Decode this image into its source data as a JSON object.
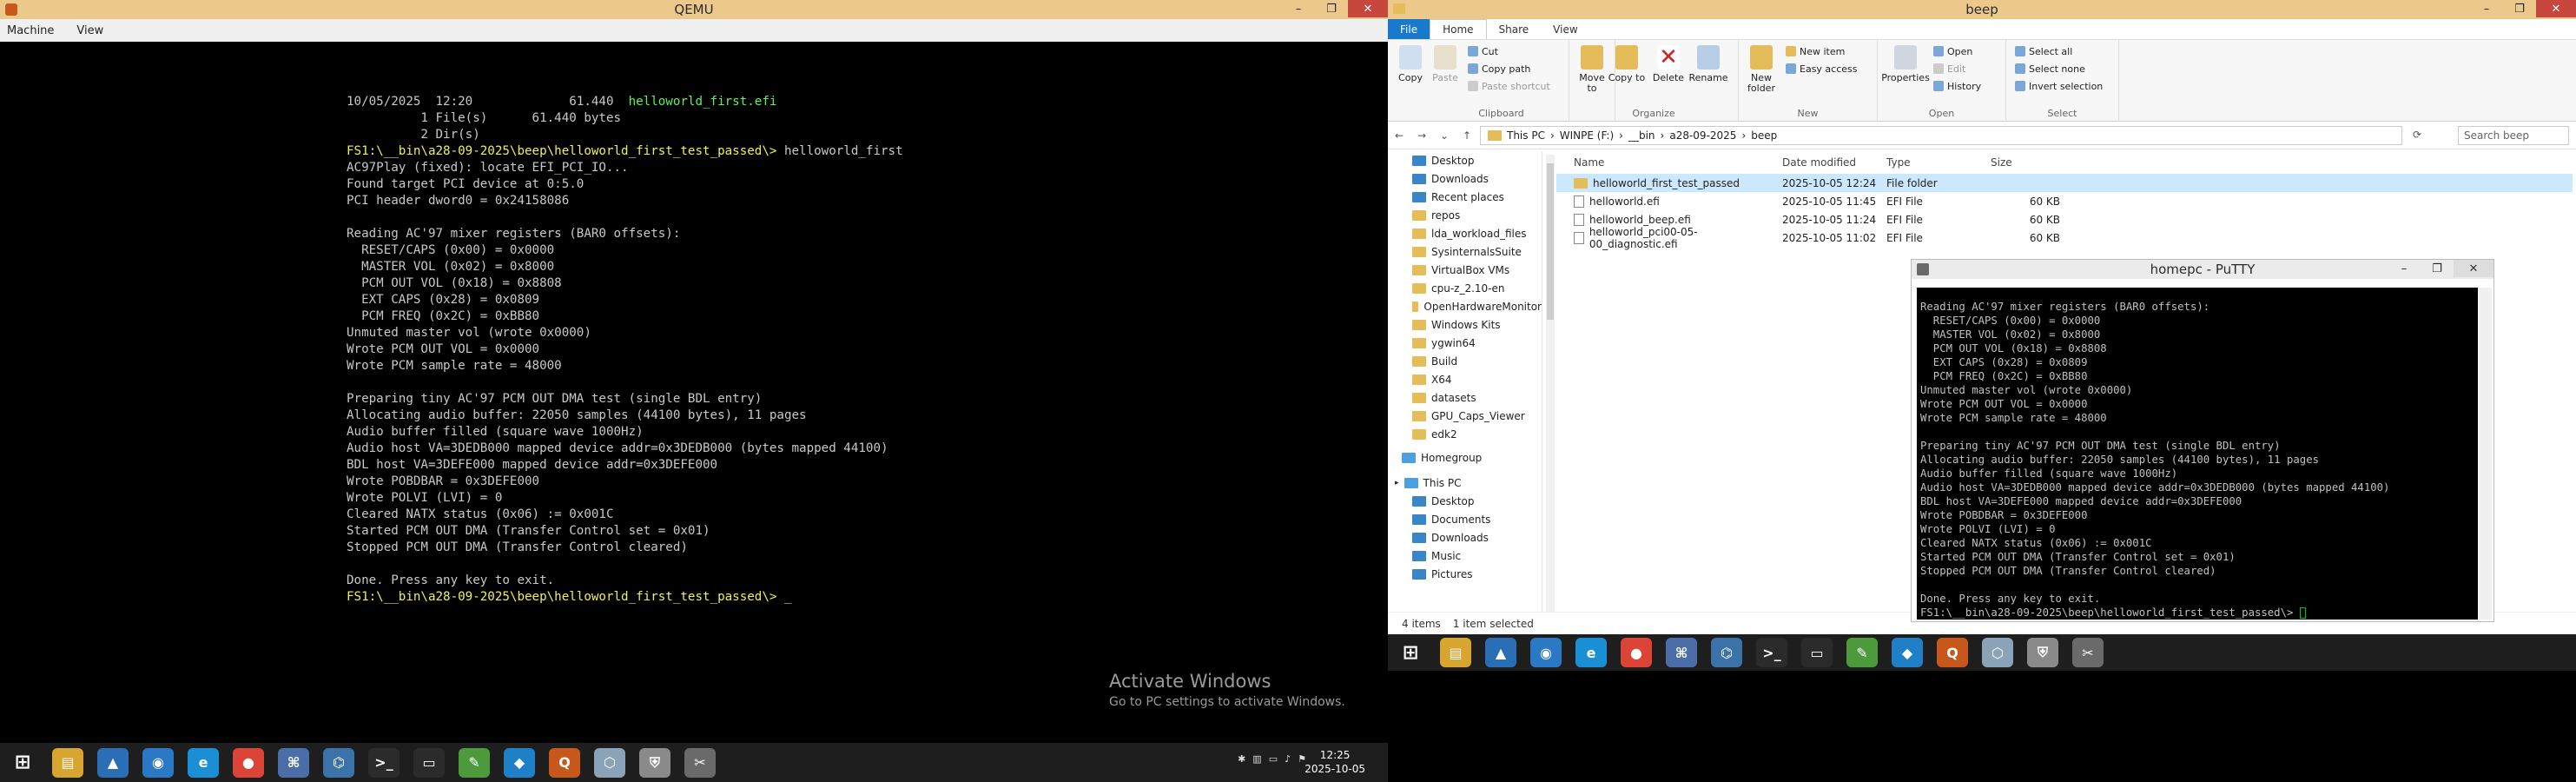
{
  "qemu": {
    "title": "QEMU",
    "menu": [
      "Machine",
      "View"
    ],
    "window_buttons": [
      "–",
      "❐",
      "✕"
    ],
    "lines": [
      {
        "t": "10/05/2025  12:20             61.440  ",
        "hl": "helloworld_first.efi",
        "c": "g"
      },
      {
        "t": "          1 File(s)      61.440 bytes"
      },
      {
        "t": "          2 Dir(s)"
      },
      {
        "t": "FS1:\\__bin\\a28-09-2025\\beep\\helloworld_first_test_passed\\> ",
        "c0": "y",
        "hl": "helloworld_first",
        "c": "w"
      },
      {
        "t": "AC97Play (fixed): locate EFI_PCI_IO..."
      },
      {
        "t": "Found target PCI device at 0:5.0"
      },
      {
        "t": "PCI header dword0 = 0x24158086"
      },
      {
        "t": ""
      },
      {
        "t": "Reading AC'97 mixer registers (BAR0 offsets):"
      },
      {
        "t": "  RESET/CAPS (0x00) = 0x0000"
      },
      {
        "t": "  MASTER VOL (0x02) = 0x8000"
      },
      {
        "t": "  PCM OUT VOL (0x18) = 0x8808"
      },
      {
        "t": "  EXT CAPS (0x28) = 0x0809"
      },
      {
        "t": "  PCM FREQ (0x2C) = 0xBB80"
      },
      {
        "t": "Unmuted master vol (wrote 0x0000)"
      },
      {
        "t": "Wrote PCM OUT VOL = 0x0000"
      },
      {
        "t": "Wrote PCM sample rate = 48000"
      },
      {
        "t": ""
      },
      {
        "t": "Preparing tiny AC'97 PCM OUT DMA test (single BDL entry)"
      },
      {
        "t": "Allocating audio buffer: 22050 samples (44100 bytes), 11 pages"
      },
      {
        "t": "Audio buffer filled (square wave 1000Hz)"
      },
      {
        "t": "Audio host VA=3DEDB000 mapped device addr=0x3DEDB000 (bytes mapped 44100)"
      },
      {
        "t": "BDL host VA=3DEFE000 mapped device addr=0x3DEFE000"
      },
      {
        "t": "Wrote POBDBAR = 0x3DEFE000"
      },
      {
        "t": "Wrote POLVI (LVI) = 0"
      },
      {
        "t": "Cleared NATX status (0x06) := 0x001C"
      },
      {
        "t": "Started PCM OUT DMA (Transfer Control set = 0x01)"
      },
      {
        "t": "Stopped PCM OUT DMA (Transfer Control cleared)"
      },
      {
        "t": ""
      },
      {
        "t": "Done. Press any key to exit."
      },
      {
        "t": "FS1:\\__bin\\a28-09-2025\\beep\\helloworld_first_test_passed\\> _",
        "c0": "y"
      }
    ],
    "activate_title": "Activate Windows",
    "activate_sub": "Go to PC settings to activate Windows.",
    "clock_time": "12:25",
    "clock_date": "2025-10-05"
  },
  "explorer": {
    "title": "beep",
    "tabs": [
      "File",
      "Home",
      "Share",
      "View"
    ],
    "groups": [
      "Clipboard",
      "Organize",
      "New",
      "Open",
      "Select"
    ],
    "buttons": {
      "copy": "Copy",
      "paste": "Paste",
      "cut": "Cut",
      "copy_path": "Copy path",
      "paste_shortcut": "Paste shortcut",
      "move_to": "Move to",
      "copy_to": "Copy to",
      "delete": "Delete",
      "rename": "Rename",
      "new_folder": "New folder",
      "new_item": "New item",
      "easy_access": "Easy access",
      "properties": "Properties",
      "open": "Open",
      "edit": "Edit",
      "history": "History",
      "select_all": "Select all",
      "select_none": "Select none",
      "invert_selection": "Invert selection"
    },
    "path": [
      "This PC",
      "WINPE (F:)",
      "__bin",
      "a28-09-2025",
      "beep"
    ],
    "search_placeholder": "Search beep",
    "nav_items": [
      "Desktop",
      "Downloads",
      "Recent places",
      "repos",
      "lda_workload_files",
      "SysinternalsSuite",
      "VirtualBox VMs",
      "cpu-z_2.10-en",
      "OpenHardwareMonitor",
      "Windows Kits",
      "ygwin64",
      "Build",
      "X64",
      "datasets",
      "GPU_Caps_Viewer",
      "edk2"
    ],
    "homegroup": "Homegroup",
    "thispc": "This PC",
    "pc_items": [
      "Desktop",
      "Documents",
      "Downloads",
      "Music",
      "Pictures"
    ],
    "columns": [
      "Name",
      "Date modified",
      "Type",
      "Size"
    ],
    "files": [
      {
        "name": "helloworld_first_test_passed",
        "date": "2025-10-05 12:24",
        "type": "File folder",
        "size": "",
        "folder": true,
        "selected": true
      },
      {
        "name": "helloworld.efi",
        "date": "2025-10-05 11:45",
        "type": "EFI File",
        "size": "60 KB"
      },
      {
        "name": "helloworld_beep.efi",
        "date": "2025-10-05 11:24",
        "type": "EFI File",
        "size": "60 KB"
      },
      {
        "name": "helloworld_pci00-05-00_diagnostic.efi",
        "date": "2025-10-05 11:02",
        "type": "EFI File",
        "size": "60 KB"
      }
    ],
    "status_count": "4 items",
    "status_sel": "1 item selected"
  },
  "putty": {
    "title": "homepc - PuTTY",
    "lines": [
      "Reading AC'97 mixer registers (BAR0 offsets):",
      "  RESET/CAPS (0x00) = 0x0000",
      "  MASTER VOL (0x02) = 0x8000",
      "  PCM OUT VOL (0x18) = 0x8808",
      "  EXT CAPS (0x28) = 0x0809",
      "  PCM FREQ (0x2C) = 0xBB80",
      "Unmuted master vol (wrote 0x0000)",
      "Wrote PCM OUT VOL = 0x0000",
      "Wrote PCM sample rate = 48000",
      "",
      "Preparing tiny AC'97 PCM OUT DMA test (single BDL entry)",
      "Allocating audio buffer: 22050 samples (44100 bytes), 11 pages",
      "Audio buffer filled (square wave 1000Hz)",
      "Audio host VA=3DEDB000 mapped device addr=0x3DEDB000 (bytes mapped 44100)",
      "BDL host VA=3DEFE000 mapped device addr=0x3DEFE000",
      "Wrote POBDBAR = 0x3DEFE000",
      "Wrote POLVI (LVI) = 0",
      "Cleared NATX status (0x06) := 0x001C",
      "Started PCM OUT DMA (Transfer Control set = 0x01)",
      "Stopped PCM OUT DMA (Transfer Control cleared)",
      "",
      "Done. Press any key to exit.",
      "FS1:\\__bin\\a28-09-2025\\beep\\helloworld_first_test_passed\\> "
    ]
  },
  "taskbar": {
    "apps": [
      {
        "icon": "start-icon",
        "color": "#1e1e1e",
        "g": "⊞"
      },
      {
        "icon": "file-explorer-icon",
        "color": "#d9a531",
        "g": "▤"
      },
      {
        "icon": "shark-app-icon",
        "color": "#2a6fb6",
        "g": "▲"
      },
      {
        "icon": "network-app-icon",
        "color": "#2b78c4",
        "g": "◉"
      },
      {
        "icon": "edge-icon",
        "color": "#1b8fd6",
        "g": "e"
      },
      {
        "icon": "chrome-icon",
        "color": "#db4437",
        "g": "●"
      },
      {
        "icon": "network-monitor-icon",
        "color": "#4c6ea8",
        "g": "⌘"
      },
      {
        "icon": "python-icon",
        "color": "#3b73a8",
        "g": "⌬"
      },
      {
        "icon": "terminal-icon",
        "color": "#2b2b2b",
        "g": ">_"
      },
      {
        "icon": "console-icon",
        "color": "#2b2b2b",
        "g": "▭"
      },
      {
        "icon": "notepad-icon",
        "color": "#4c9a3c",
        "g": "✎"
      },
      {
        "icon": "vscode-icon",
        "color": "#1f80c8",
        "g": "◆"
      },
      {
        "icon": "qemu-icon",
        "color": "#c8571b",
        "g": "Q"
      },
      {
        "icon": "disk-app-icon",
        "color": "#8aa3b8",
        "g": "⬡"
      },
      {
        "icon": "shield-app-icon",
        "color": "#8a8a8a",
        "g": "⛨"
      },
      {
        "icon": "tools-app-icon",
        "color": "#6a6a6a",
        "g": "✂"
      }
    ]
  },
  "colors": {
    "file_tab": "#1979ca",
    "title_bar": "#ecc98b",
    "close": "#c7463e"
  }
}
